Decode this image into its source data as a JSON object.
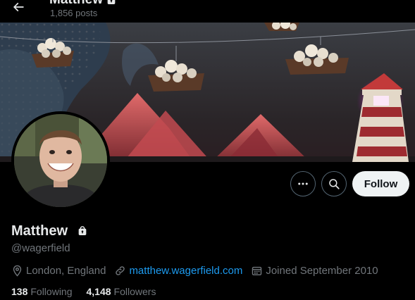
{
  "header": {
    "title": "Matthew",
    "posts_count": "1,856 posts"
  },
  "profile": {
    "display_name": "Matthew",
    "handle": "@wagerfield",
    "location": "London, England",
    "website": "matthew.wagerfield.com",
    "joined": "Joined September 2010",
    "following_count": "138",
    "following_label": "Following",
    "followers_count": "4,148",
    "followers_label": "Followers"
  },
  "actions": {
    "follow_label": "Follow"
  },
  "icons": {
    "back": "arrow-left-icon",
    "lock": "lock-icon",
    "more": "more-dots-icon",
    "search": "search-icon",
    "location": "location-pin-icon",
    "link": "link-icon",
    "calendar": "calendar-icon"
  },
  "colors": {
    "background": "#000000",
    "text_primary": "#e7e9ea",
    "text_secondary": "#71767b",
    "link": "#1d9bf0",
    "follow_button_bg": "#eff3f4",
    "follow_button_text": "#0f1419",
    "button_border": "#536471"
  }
}
